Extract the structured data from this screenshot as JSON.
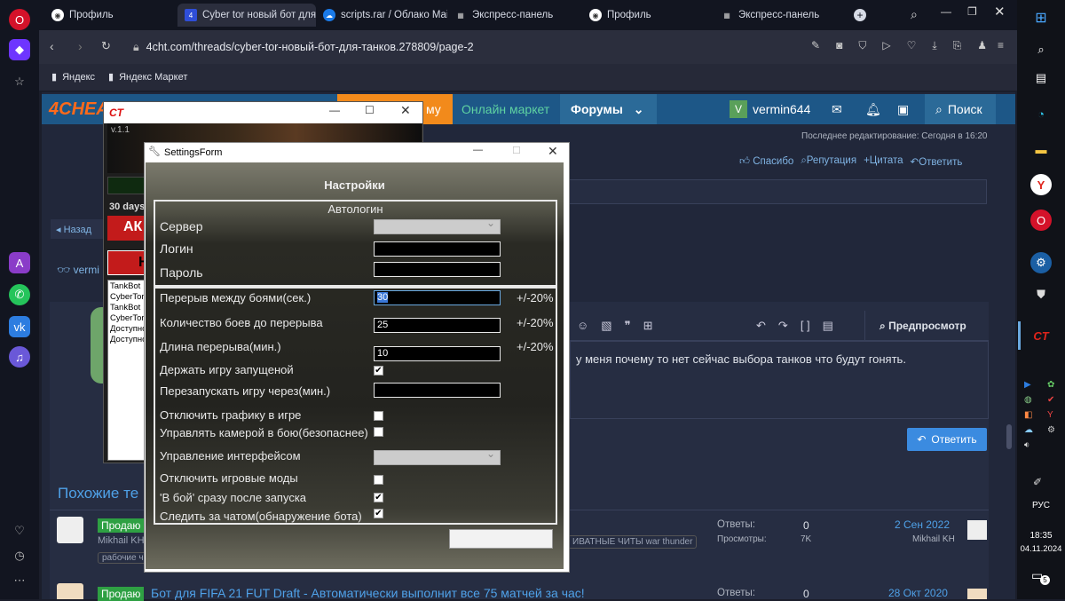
{
  "browser": {
    "tabs": [
      {
        "label": "Профиль"
      },
      {
        "label": "Cyber tor новый бот для"
      },
      {
        "label": "scripts.rar / Облако Mail"
      },
      {
        "label": "Экспресс-панель"
      },
      {
        "label": "Профиль"
      },
      {
        "label": "Экспресс-панель"
      }
    ],
    "url": "4cht.com/threads/cyber-tor-новый-бот-для-танков.278809/page-2",
    "bookmarks": [
      {
        "label": "Яндекс"
      },
      {
        "label": "Яндекс Маркет"
      }
    ]
  },
  "site": {
    "logo": "4CHEAT",
    "nav_partial": "му",
    "nav_market": "Онлайн маркет",
    "nav_forums": "Форумы",
    "user": "vermin644",
    "user_initial": "V",
    "search": "Поиск",
    "edited": "Последнее редактирование: Сегодня в 16:20",
    "actions": [
      "Спасибо",
      "Репутация",
      "Цитата",
      "Ответить"
    ],
    "back": "Назад",
    "username_partial": "vermi",
    "editor_preview": "Предпросмотр",
    "editor_text": "у меня почему то нет сейчас выбора танков что будут гонять.",
    "reply_button": "Ответить",
    "similar_title": "Похожие те",
    "thread1": {
      "prefix": "Продаю",
      "author": "Mikhail KH",
      "tag": "рабочие ч",
      "tag2": "ИВАТНЫЕ ЧИТЫ war thunder",
      "answers_label": "Ответы:",
      "answers": "0",
      "views_label": "Просмотры:",
      "views": "7K",
      "date": "2 Сен 2022",
      "last_author": "Mikhail KH"
    },
    "thread2": {
      "prefix": "Продаю",
      "title": "Бот для FIFA 21 FUT Draft - Автоматически выполнит все 75 матчей за час!",
      "answers_label": "Ответы:",
      "answers": "0",
      "date": "28 Окт 2020"
    }
  },
  "ct_window": {
    "title_logo": "CT",
    "version": "v.1.1",
    "days": "30 days",
    "btn1_partial": "АК",
    "btn2_partial": "Н",
    "log": [
      "TankBot",
      "CyberTor",
      "TankBot",
      "CyberTor",
      "Доступно",
      "Доступно"
    ]
  },
  "settings": {
    "window_title": "SettingsForm",
    "header": "Настройки",
    "autologin_title": "Автологин",
    "server_label": "Сервер",
    "login_label": "Логин",
    "password_label": "Пароль",
    "break_label": "Перерыв между боями(сек.)",
    "break_value": "30",
    "break_pct": "+/-20%",
    "battles_label": "Количество боев до перерыва",
    "battles_value": "25",
    "battles_pct": "+/-20%",
    "length_label": "Длина перерыва(мин.)",
    "length_value": "10",
    "length_pct": "+/-20%",
    "keep_running": "Держать игру запущеной",
    "keep_running_checked": true,
    "restart_label": "Перезапускать игру через(мин.)",
    "disable_graphics": "Отключить графику в игре",
    "disable_graphics_checked": false,
    "camera": "Управлять камерой в бою(безопаснее)",
    "camera_checked": false,
    "interface": "Управление интерфейсом",
    "disable_mods": "Отключить игровые моды",
    "disable_mods_checked": false,
    "battle_after_start": "'В бой' сразу после запуска",
    "battle_after_start_checked": true,
    "chat_watch": "Следить за чатом(обнаружение бота)",
    "chat_watch_checked": true
  },
  "taskbar": {
    "lang": "РУС",
    "time": "18:35",
    "date": "04.11.2024",
    "notif": "5"
  },
  "colors": {
    "accent_blue": "#1d5787",
    "settings_bg": "#23231f",
    "ct_red": "#c31b1b"
  }
}
